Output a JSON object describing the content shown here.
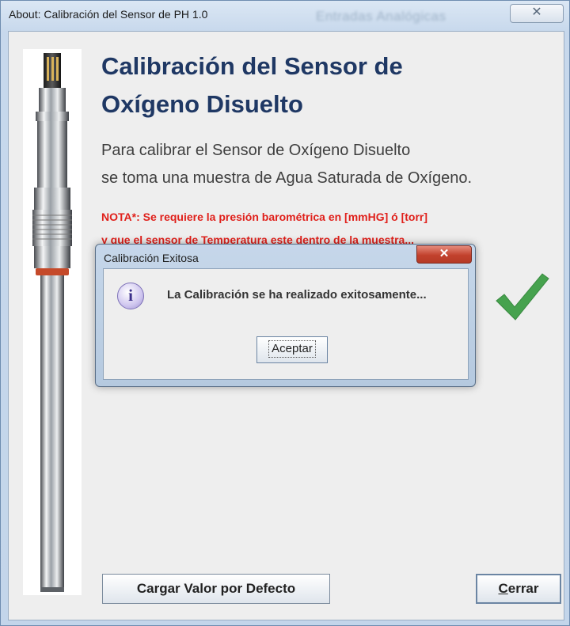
{
  "window": {
    "title": "About: Calibración del Sensor de PH 1.0",
    "background_title": "Entradas Analógicas",
    "close_glyph": "✕"
  },
  "main": {
    "title_line1": "Calibración del Sensor de",
    "title_line2": "Oxígeno Disuelto",
    "desc_line1": "Para calibrar el Sensor de Oxígeno Disuelto",
    "desc_line2": "se toma una muestra de Agua Saturada de Oxígeno.",
    "nota_line1": "NOTA*: Se requiere la presión barométrica en [mmHG] ó [torr]",
    "nota_line2": "y que el sensor de Temperatura este dentro de la muestra..."
  },
  "buttons": {
    "default_label": "Cargar Valor por Defecto",
    "close_mnemonic": "C",
    "close_rest": "errar"
  },
  "dialog": {
    "title": "Calibración Exitosa",
    "close_glyph": "✕",
    "icon_glyph": "i",
    "message": "La Calibración se ha realizado exitosamente...",
    "ok_label": "Aceptar"
  },
  "colors": {
    "title_blue": "#1f3864",
    "nota_red": "#e0201b",
    "check_green": "#46a24e"
  }
}
